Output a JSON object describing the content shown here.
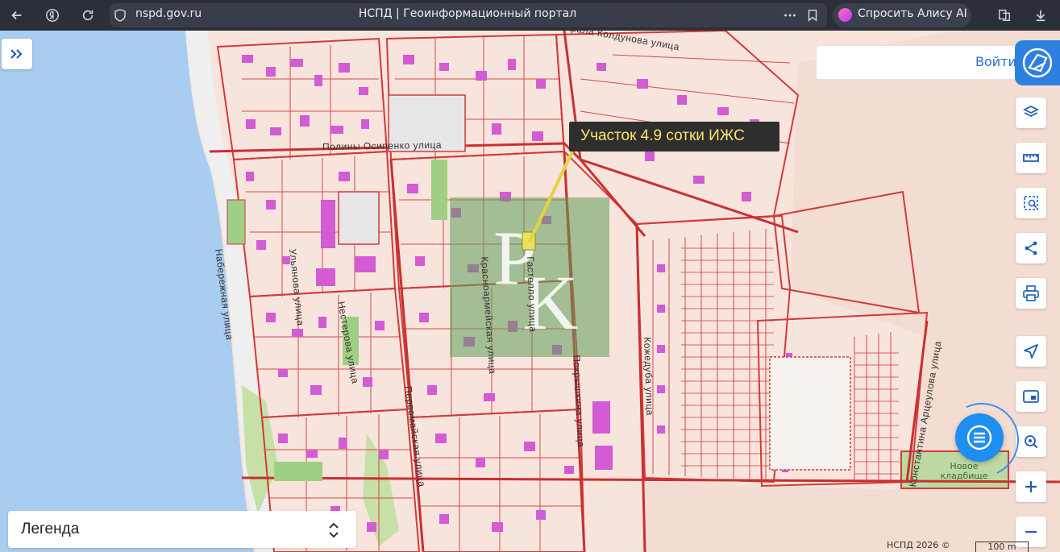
{
  "browser": {
    "url": "nspd.gov.ru",
    "title": "НСПД | Геоинформационный портал",
    "ai_button": "Спросить Алису AI"
  },
  "map": {
    "search_placeholder": "",
    "login": "Войти",
    "tooltip": "Участок 4.9 сотки ИЖС",
    "legend": "Легенда",
    "copyright": "НСПД 2026 ©",
    "scale": "100 m",
    "cemetery": "Новое кладбище",
    "streets": {
      "koldunova": "Марала Колдунова улица",
      "osipenko": "Полины Осипенко улица",
      "naberezhnaya": "Набережная улица",
      "ulyanova": "Ульянова улица",
      "nesterova": "Нестерова улица",
      "pervomayskaya": "Первомайская улица",
      "krasnoarmeyskaya": "Красноармейская улица",
      "gastello": "Гастелло улица",
      "pokryshkina": "Покрышкина улица",
      "kozhedub": "Кожедуба улица",
      "artseulova": "Константина Арцеулова улица"
    }
  },
  "colors": {
    "water": "#a9cdf0",
    "land": "#f7e4dc",
    "parcel_border": "#d23a3a",
    "building": "#d35bd3",
    "accent": "#2d80e0"
  }
}
